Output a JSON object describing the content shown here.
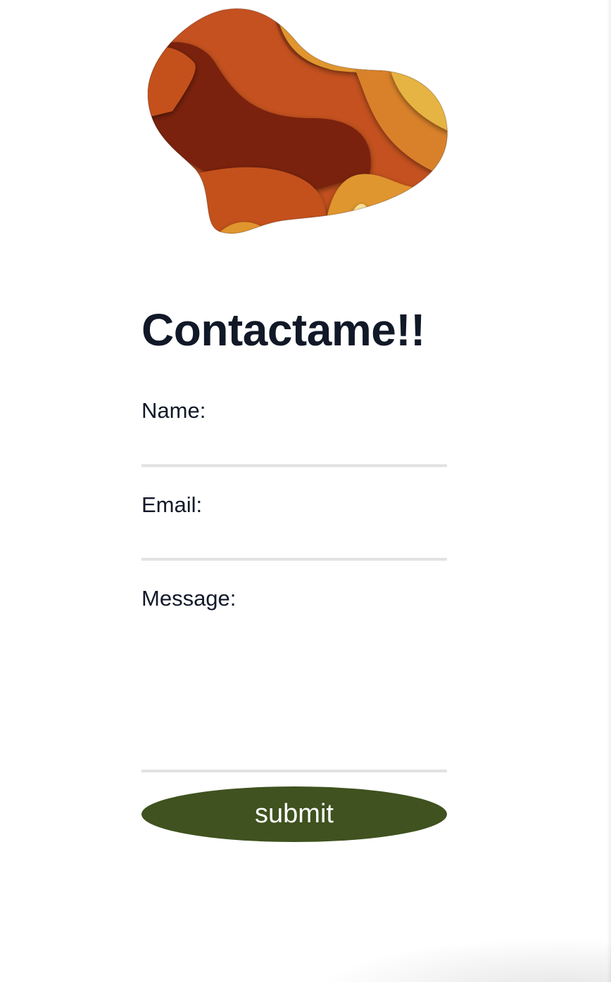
{
  "blob": {
    "icon": "abstract-blob-illustration",
    "colors": [
      "#e0a038",
      "#c4511f",
      "#8a2a10",
      "#5c1808",
      "#e8c050"
    ]
  },
  "form": {
    "title": "Contactame!!",
    "name_label": "Name:",
    "name_value": "",
    "email_label": "Email:",
    "email_value": "",
    "message_label": "Message:",
    "message_value": "",
    "submit_label": "submit"
  },
  "colors": {
    "title": "#111827",
    "label": "#111827",
    "underline": "#e2e2e2",
    "button_bg": "#3f521f",
    "button_text": "#ffffff"
  }
}
